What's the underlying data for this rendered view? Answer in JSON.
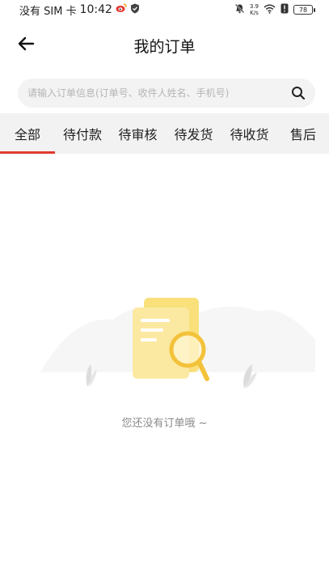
{
  "status_bar": {
    "carrier": "没有 SIM 卡",
    "time": "10:42",
    "net_speed_value": "3.9",
    "net_speed_unit": "K/s",
    "battery": "78"
  },
  "header": {
    "title": "我的订单"
  },
  "search": {
    "placeholder": "请输入订单信息(订单号、收件人姓名、手机号)",
    "value": ""
  },
  "tabs": [
    {
      "label": "全部",
      "active": true
    },
    {
      "label": "待付款",
      "active": false
    },
    {
      "label": "待审核",
      "active": false
    },
    {
      "label": "待发货",
      "active": false
    },
    {
      "label": "待收货",
      "active": false
    },
    {
      "label": "售后",
      "active": false
    }
  ],
  "empty_state": {
    "message": "您还没有订单哦 ~"
  },
  "colors": {
    "accent": "#e23a2e",
    "tab_bg": "#f2f2f2",
    "search_bg": "#f3f3f3",
    "illustration_yellow": "#f7d46a"
  }
}
